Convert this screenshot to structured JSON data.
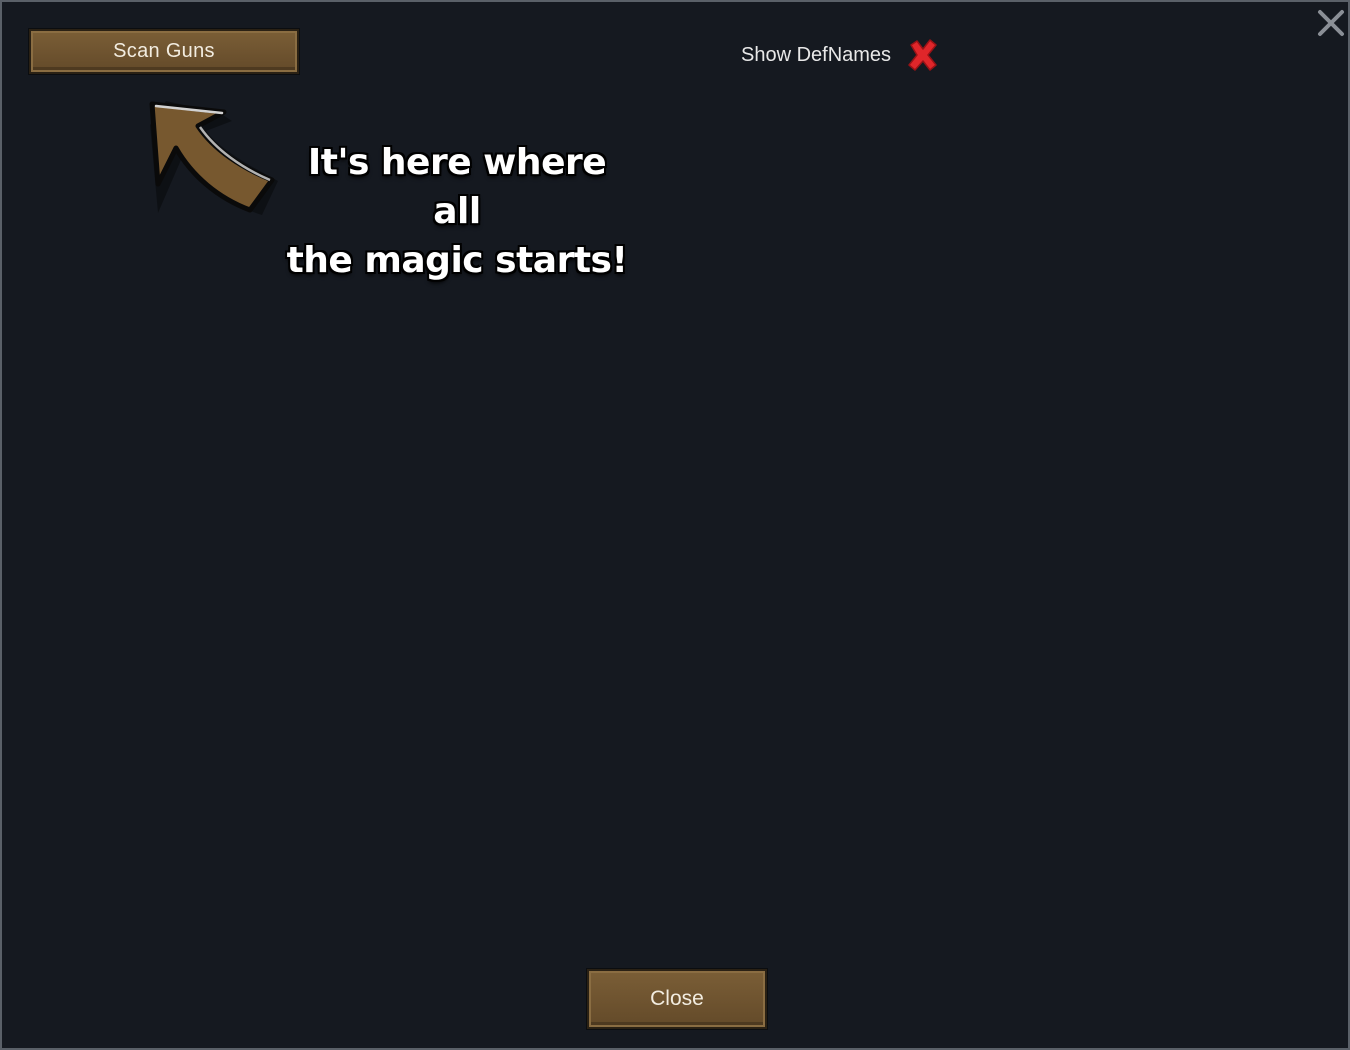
{
  "dialog": {
    "scan_button_label": "Scan Guns",
    "show_defnames_label": "Show DefNames",
    "show_defnames_checked": false,
    "close_button_label": "Close"
  },
  "annotation": {
    "line1": "It's here where all",
    "line2": "the magic starts!"
  },
  "icons": {
    "window_close": "close-x-icon",
    "checkbox_state": "red-cross-icon",
    "pointer": "curved-arrow-icon"
  },
  "colors": {
    "background": "#151920",
    "button": "#6f5430",
    "checkbox_off": "#e0262a",
    "text": "#f2ece0"
  }
}
